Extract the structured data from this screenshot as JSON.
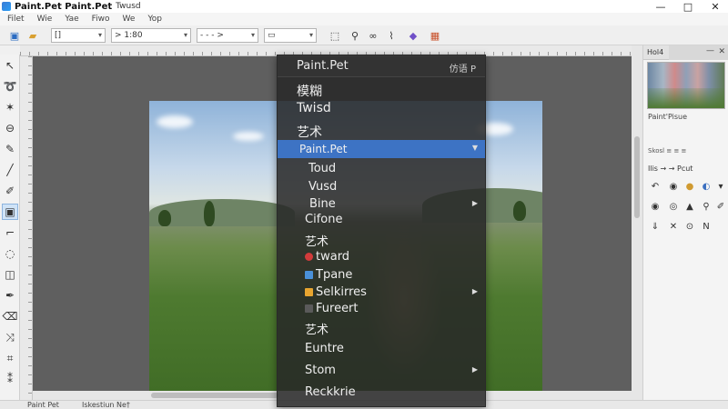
{
  "window": {
    "title": "Paint.Pet Paint.Pet",
    "subtitle": "Twusd",
    "controls": {
      "minimize": "—",
      "maximize": "□",
      "close": "✕"
    }
  },
  "menu": [
    "Filet",
    "Wie",
    "Yae",
    "Fiwo",
    "We",
    "Yop"
  ],
  "toolbar": {
    "icons": [
      "new-image-icon",
      "open-folder-icon",
      "select-icon",
      "zoom-icon",
      "link-icon",
      "paint-bucket-icon",
      "brush-icon",
      "palette-icon"
    ],
    "combo1_value": "[]",
    "combo2_value": "> 1:80",
    "combo3_value": "- - - >",
    "shape_combo_value": "▭"
  },
  "context_menu": {
    "title": "Paint.Pet",
    "extra": "仿语 P",
    "items": [
      {
        "label": "模糊",
        "submenu": false,
        "highlight": false,
        "icon": null
      },
      {
        "label": "Twisd",
        "submenu": false,
        "highlight": false,
        "icon": null
      },
      {
        "label": "艺术",
        "submenu": false,
        "highlight": false,
        "icon": null
      },
      {
        "label": "Paint.Pet",
        "submenu": true,
        "highlight": true,
        "icon": null
      },
      {
        "label": "Toud",
        "submenu": false,
        "highlight": false,
        "icon": null
      },
      {
        "label": "Vusd",
        "submenu": false,
        "highlight": false,
        "icon": null
      },
      {
        "label": "Bine",
        "submenu": true,
        "highlight": false,
        "icon": null
      },
      {
        "label": "Cifone",
        "submenu": false,
        "highlight": false,
        "icon": null
      },
      {
        "label": "艺术",
        "submenu": false,
        "highlight": false,
        "icon": null
      },
      {
        "label": "twa‌rd",
        "submenu": false,
        "highlight": false,
        "icon": "#d23b3b"
      },
      {
        "label": "Tpane",
        "submenu": false,
        "highlight": false,
        "icon": "#4a90d9"
      },
      {
        "label": "Selkirres",
        "submenu": true,
        "highlight": false,
        "icon": "#e8a530"
      },
      {
        "label": "Fureert",
        "submenu": false,
        "highlight": false,
        "icon": "#5a5a5a"
      },
      {
        "label": "艺术",
        "submenu": false,
        "highlight": false,
        "icon": null
      },
      {
        "label": "Euntre",
        "submenu": false,
        "highlight": false,
        "icon": null
      },
      {
        "label": "Stom",
        "submenu": true,
        "highlight": false,
        "icon": null
      },
      {
        "label": "Reckkrie",
        "submenu": false,
        "highlight": false,
        "icon": null
      }
    ]
  },
  "right_panel": {
    "title": "Hol4",
    "label": "Paint'Pisue",
    "sub": "Skosl ≡ ≡ ≡",
    "history_label": "Ilis → → Pcut"
  },
  "status": {
    "left": "Paint Pet",
    "right": "Iskestiun Ne†"
  },
  "colors": {
    "accent": "#3d73c4",
    "menu_bg": "#282828",
    "canvas_bg": "#5f5f5f"
  }
}
